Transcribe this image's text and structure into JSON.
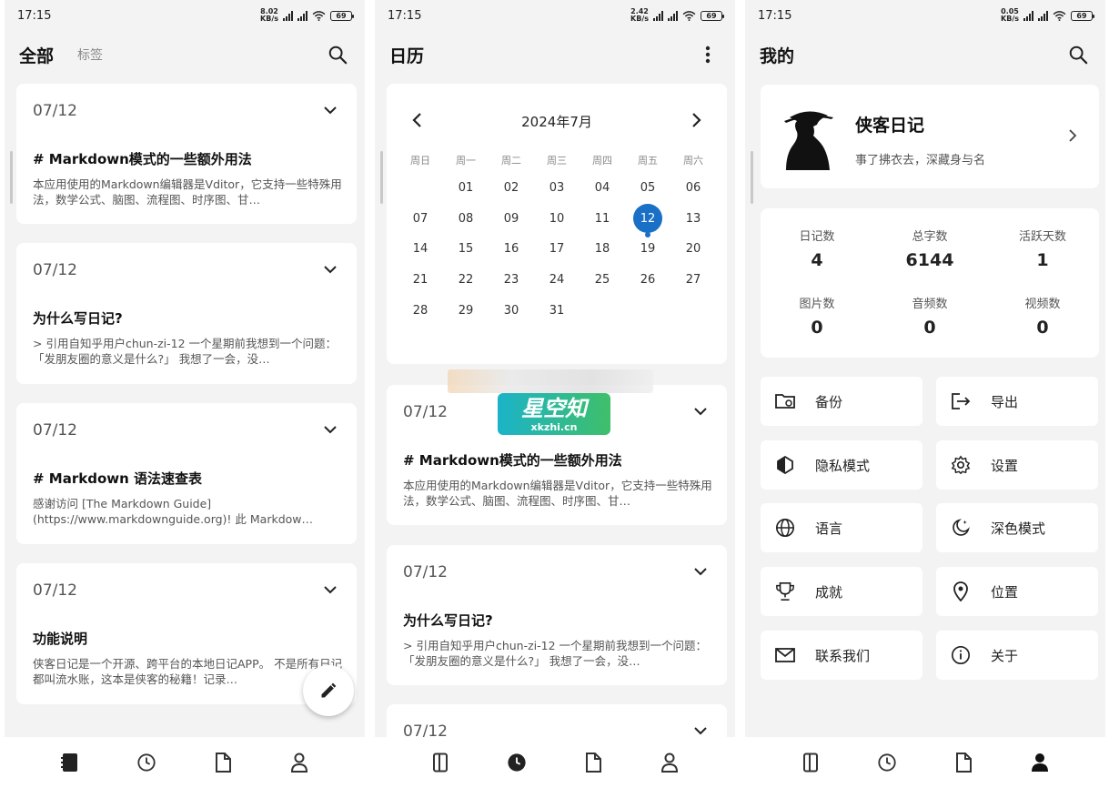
{
  "status_bar": {
    "screen1": {
      "time": "17:15",
      "speed_value": "8.02",
      "speed_unit": "KB/s",
      "battery": "69"
    },
    "screen2": {
      "time": "17:15",
      "speed_value": "2.42",
      "speed_unit": "KB/s",
      "battery": "69"
    },
    "screen3": {
      "time": "17:15",
      "speed_value": "0.05",
      "speed_unit": "KB/s",
      "battery": "69"
    }
  },
  "screen1": {
    "title": "全部",
    "tab_tags": "标签",
    "entries": [
      {
        "date": "07/12",
        "title": "# Markdown模式的一些额外用法",
        "excerpt": "本应用使用的Markdown编辑器是Vditor，它支持一些特殊用法，数学公式、脑图、流程图、时序图、甘…"
      },
      {
        "date": "07/12",
        "title": "为什么写日记?",
        "excerpt": "> 引用自知乎用户chun-zi-12 一个星期前我想到一个问题：「发朋友圈的意义是什么?」 我想了一会，没…"
      },
      {
        "date": "07/12",
        "title": "# Markdown 语法速查表",
        "excerpt": "感谢访问 [The Markdown Guide](https://www.markdownguide.org)! 此 Markdow…"
      },
      {
        "date": "07/12",
        "title": "功能说明",
        "excerpt": "侠客日记是一个开源、跨平台的本地日记APP。 不是所有日记都叫流水账，这本是侠客的秘籍！记录…"
      }
    ]
  },
  "screen2": {
    "title": "日历",
    "calendar": {
      "month": "2024年7月",
      "weekdays": [
        "周日",
        "周一",
        "周二",
        "周三",
        "周四",
        "周五",
        "周六"
      ],
      "leading_blanks": 1,
      "days_in_month": 31,
      "selected_day": 12
    },
    "entries": [
      {
        "date": "07/12",
        "title": "# Markdown模式的一些额外用法",
        "excerpt": "本应用使用的Markdown编辑器是Vditor，它支持一些特殊用法，数学公式、脑图、流程图、时序图、甘…"
      },
      {
        "date": "07/12",
        "title": "为什么写日记?",
        "excerpt": "> 引用自知乎用户chun-zi-12 一个星期前我想到一个问题：「发朋友圈的意义是什么?」 我想了一会，没…"
      },
      {
        "date": "07/12",
        "title": "",
        "excerpt": ""
      }
    ]
  },
  "screen3": {
    "title": "我的",
    "profile": {
      "name": "侠客日记",
      "motto": "事了拂衣去，深藏身与名"
    },
    "stats": [
      {
        "label": "日记数",
        "value": "4"
      },
      {
        "label": "总字数",
        "value": "6144"
      },
      {
        "label": "活跃天数",
        "value": "1"
      },
      {
        "label": "图片数",
        "value": "0"
      },
      {
        "label": "音频数",
        "value": "0"
      },
      {
        "label": "视频数",
        "value": "0"
      }
    ],
    "menu": [
      {
        "label": "备份",
        "icon": "folder-sync-icon"
      },
      {
        "label": "导出",
        "icon": "export-icon"
      },
      {
        "label": "隐私模式",
        "icon": "privacy-icon"
      },
      {
        "label": "设置",
        "icon": "gear-icon"
      },
      {
        "label": "语言",
        "icon": "globe-icon"
      },
      {
        "label": "深色模式",
        "icon": "moon-icon"
      },
      {
        "label": "成就",
        "icon": "trophy-icon"
      },
      {
        "label": "位置",
        "icon": "location-pin-icon"
      },
      {
        "label": "联系我们",
        "icon": "mail-icon"
      },
      {
        "label": "关于",
        "icon": "info-icon"
      }
    ]
  },
  "watermark": {
    "text": "星空知",
    "url": "xkzhi.cn"
  },
  "colors": {
    "accent": "#1a6fc7",
    "background": "#f3f3f3",
    "card": "#ffffff"
  }
}
